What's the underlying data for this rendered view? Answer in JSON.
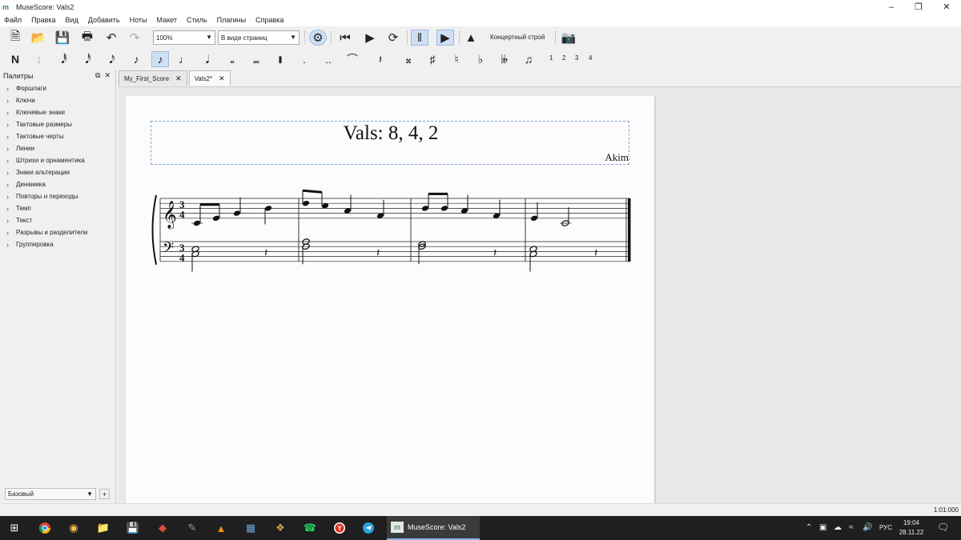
{
  "window": {
    "title": "MuseScore: Vals2"
  },
  "menu": [
    "Файл",
    "Правка",
    "Вид",
    "Добавить",
    "Ноты",
    "Макет",
    "Стиль",
    "Плагины",
    "Справка"
  ],
  "toolbar": {
    "zoom": "100%",
    "view_mode": "В виде страниц",
    "concert_pitch": "Концертный строй"
  },
  "note_input": {
    "voices": [
      "1",
      "2",
      "3",
      "4"
    ]
  },
  "palettes": {
    "header": "Палитры",
    "items": [
      "Форшлаги",
      "Ключи",
      "Ключевые знаки",
      "Тактовые размеры",
      "Тактовые черты",
      "Линии",
      "Штрихи и орнаментика",
      "Знаки альтерации",
      "Динамика",
      "Повторы и переходы",
      "Темп",
      "Текст",
      "Разрывы и разделители",
      "Группировка"
    ],
    "workspace": "Базовый",
    "add": "+"
  },
  "tabs": [
    {
      "label": "My_First_Score",
      "active": false
    },
    {
      "label": "Vals2*",
      "active": true
    }
  ],
  "score": {
    "title": "Vals: 8, 4, 2",
    "composer": "Akim",
    "time_signature": "3/4",
    "treble": [
      "C4 E4 (beamed eighths), G4 quarter, B4 quarter",
      "D5 C5 (beamed eighths), A4 quarter, F4 quarter",
      "B4 B4 (beamed eighths), A4 quarter, F4 quarter",
      "E4 quarter, C4 half"
    ],
    "bass": [
      "C3+E3 half, quarter rest",
      "F3+A3 half, quarter rest",
      "F3+G3 half, quarter rest",
      "C3+E3 half, quarter rest"
    ]
  },
  "status": {
    "time": "1:01:000"
  },
  "taskbar": {
    "active_app": "MuseScore: Vals2",
    "lang": "РУС",
    "time": "19:04",
    "date": "28.11.22",
    "notif_count": "1"
  }
}
